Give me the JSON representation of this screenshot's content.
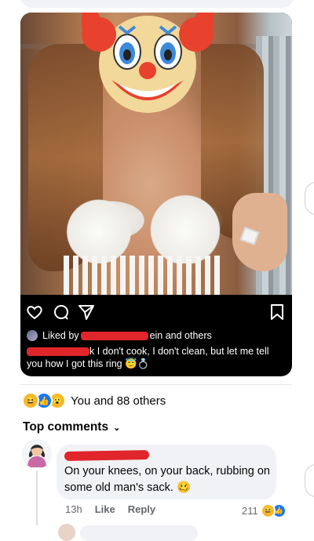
{
  "post": {
    "liked_prefix": "Liked by",
    "liked_suffix": "ein and others",
    "caption_user_tail": "k",
    "caption_text": " I don't cook, I don't clean, but let me tell you how I got this ring 😇💍"
  },
  "reactions": {
    "icons": [
      "haha-icon",
      "like-icon",
      "wow-icon"
    ],
    "summary": "You and 88 others"
  },
  "comments_header": {
    "label": "Top comments",
    "chevron": "⌄"
  },
  "comment": {
    "text": "On your knees, on your back, rubbing on some old man's sack. 🥴",
    "time": "13h",
    "like_label": "Like",
    "reply_label": "Reply",
    "reaction_count": "211"
  },
  "colors": {
    "like_blue": "#1877f2",
    "haha_yellow": "#f7b928",
    "redaction_red": "#e0262b",
    "bubble_grey": "#f0f2f5"
  }
}
